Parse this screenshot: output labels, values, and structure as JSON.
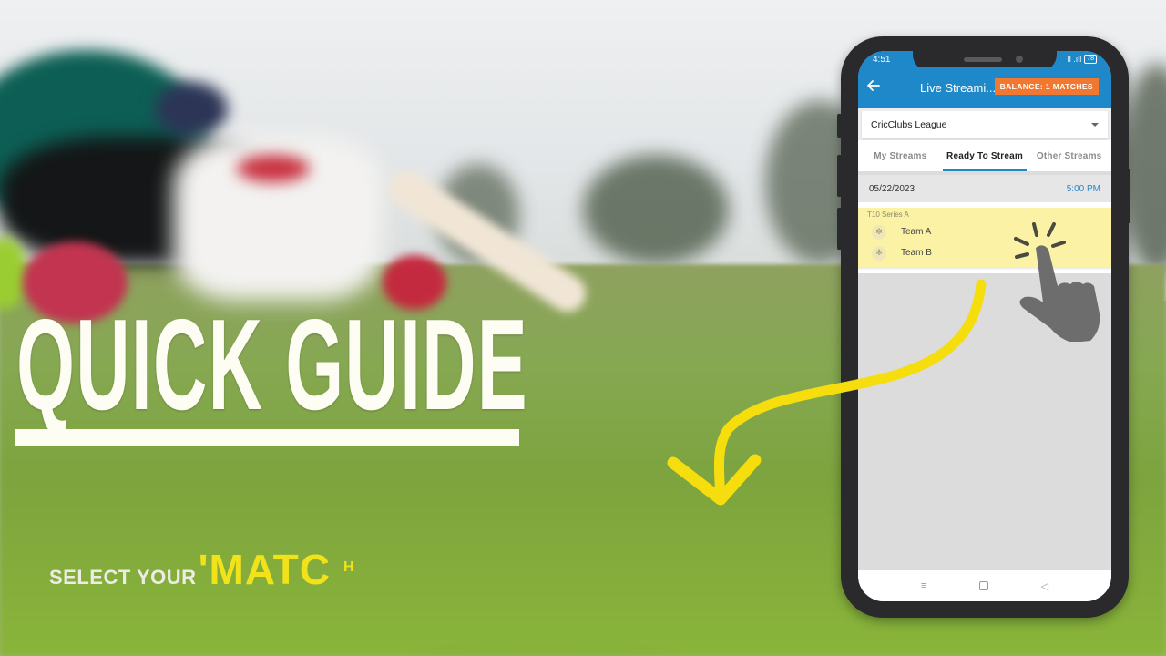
{
  "overlay": {
    "title": "QUICK GUIDE",
    "subtitle_white": "SELECT YOUR",
    "subtitle_yellow": "'MATC",
    "subtitle_trailing": "H"
  },
  "colors": {
    "app_blue": "#1e88c8",
    "balance_orange": "#f07830",
    "card_yellow": "#fbf2a6",
    "arrow_yellow": "#f5dd0e",
    "title_white": "#fdfdf4"
  },
  "phone": {
    "status_bar": {
      "time": "4:51",
      "signal_text": "ll .ıll",
      "battery": "78"
    },
    "app_bar": {
      "back_icon": "arrow-left-icon",
      "title": "Live Streami...",
      "balance_label": "BALANCE: 1 MATCHES"
    },
    "league_select": {
      "selected": "CricClubs League",
      "icon": "caret-down-icon"
    },
    "tabs": [
      {
        "label": "My Streams",
        "active": false
      },
      {
        "label": "Ready To Stream",
        "active": true
      },
      {
        "label": "Other Streams",
        "active": false
      }
    ],
    "schedule": {
      "date": "05/22/2023",
      "time": "5:00 PM"
    },
    "match": {
      "series": "T10 Series A",
      "teams": [
        {
          "name": "Team A",
          "logo": "team-logo-icon"
        },
        {
          "name": "Team B",
          "logo": "team-logo-icon"
        }
      ]
    },
    "nav_bar": {
      "recents_icon": "≡",
      "home_icon": "home-square-icon",
      "back_icon": "◁"
    }
  },
  "annotations": {
    "pointer": "tap-hand-icon",
    "arrow": "curved-arrow-icon"
  }
}
